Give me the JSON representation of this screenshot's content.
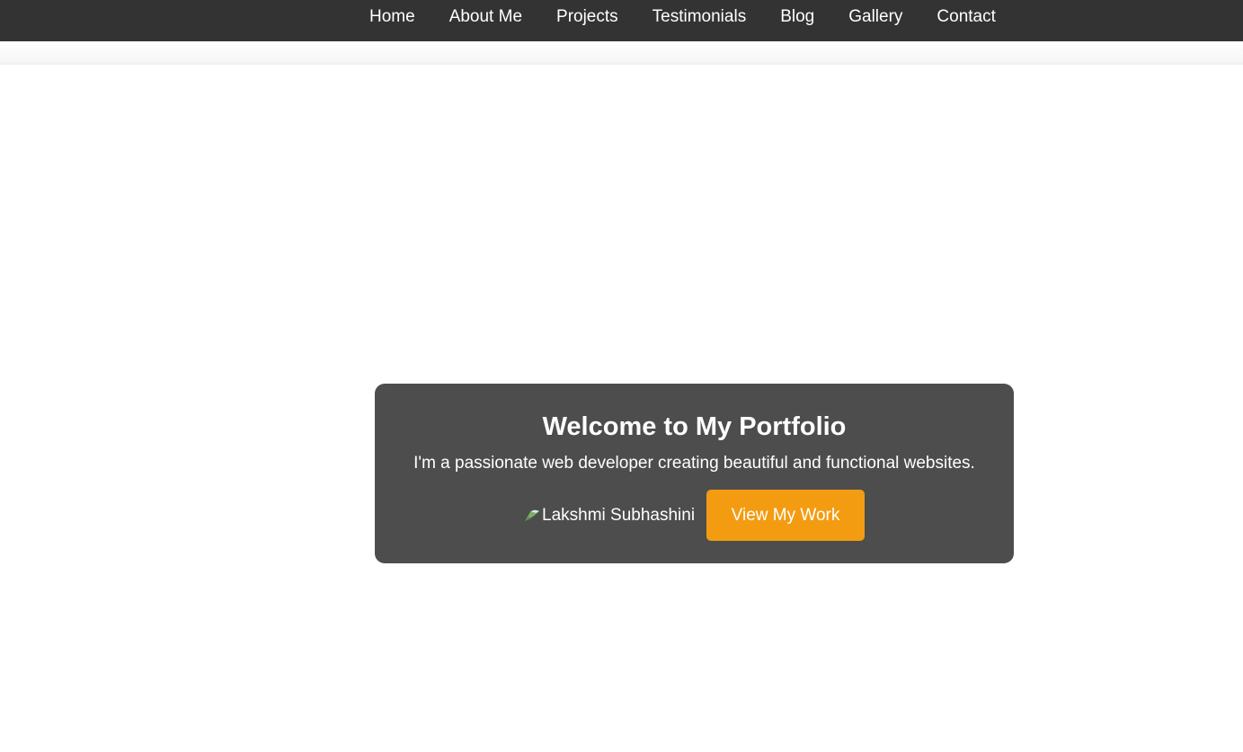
{
  "nav": {
    "items": [
      {
        "label": "Home"
      },
      {
        "label": "About Me"
      },
      {
        "label": "Projects"
      },
      {
        "label": "Testimonials"
      },
      {
        "label": "Blog"
      },
      {
        "label": "Gallery"
      },
      {
        "label": "Contact"
      }
    ]
  },
  "hero": {
    "title": "Welcome to My Portfolio",
    "subtitle": "I'm a passionate web developer creating beautiful and functional websites.",
    "image_alt": "Lakshmi Subhashini",
    "image_icon": "broken-image-icon",
    "cta_label": "View My Work"
  },
  "colors": {
    "navbar_bg": "#333333",
    "card_bg": "#4d4d4d",
    "cta_bg": "#f39c12",
    "text": "#ffffff"
  }
}
